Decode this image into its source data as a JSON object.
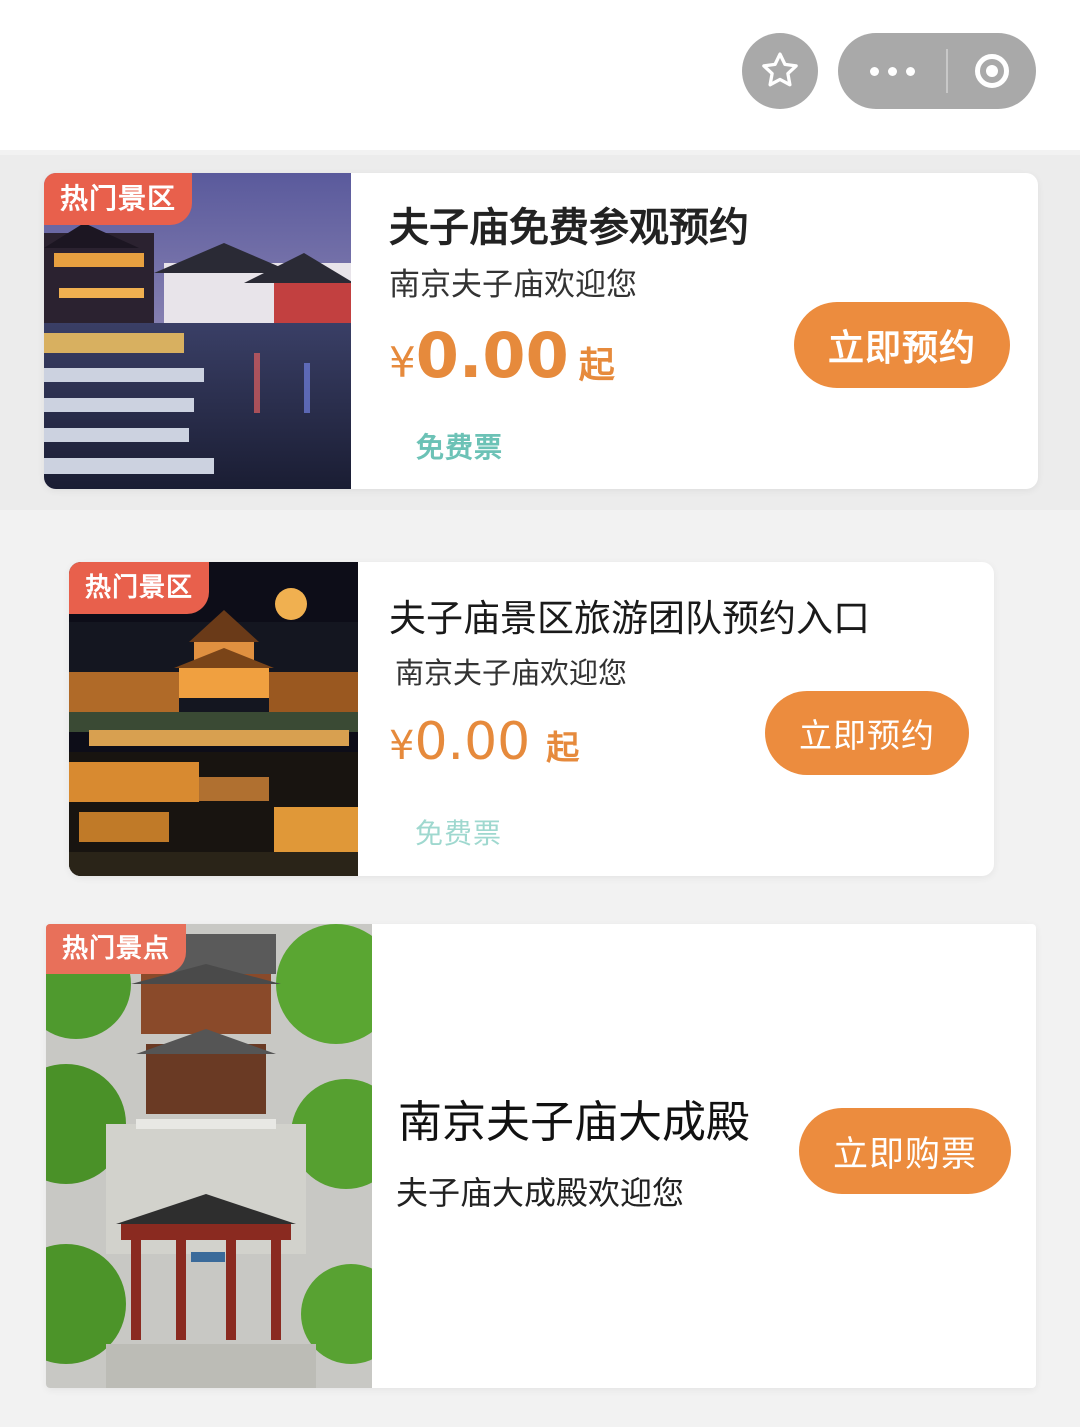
{
  "topbar": {
    "favorite_icon": "star-outline-icon",
    "more_icon": "more-dots-icon",
    "close_icon": "target-circle-icon"
  },
  "colors": {
    "accent": "#ec8c3e",
    "tag_bg": "#e8604c",
    "price": "#e68a3c",
    "free_label": "#6cc2b6"
  },
  "cards": [
    {
      "tag": "热门景区",
      "title": "夫子庙免费参观预约",
      "subtitle": "南京夫子庙欢迎您",
      "currency": "¥",
      "price": "0.00",
      "price_suffix": "起",
      "ticket_type": "免费票",
      "button": "立即预约"
    },
    {
      "tag": "热门景区",
      "title": "夫子庙景区旅游团队预约入口",
      "subtitle": "南京夫子庙欢迎您",
      "currency": "¥",
      "price": "0.00",
      "price_suffix": "起",
      "ticket_type": "免费票",
      "button": "立即预约"
    },
    {
      "tag": "热门景点",
      "title": "南京夫子庙大成殿",
      "subtitle": "夫子庙大成殿欢迎您",
      "button": "立即购票"
    }
  ]
}
